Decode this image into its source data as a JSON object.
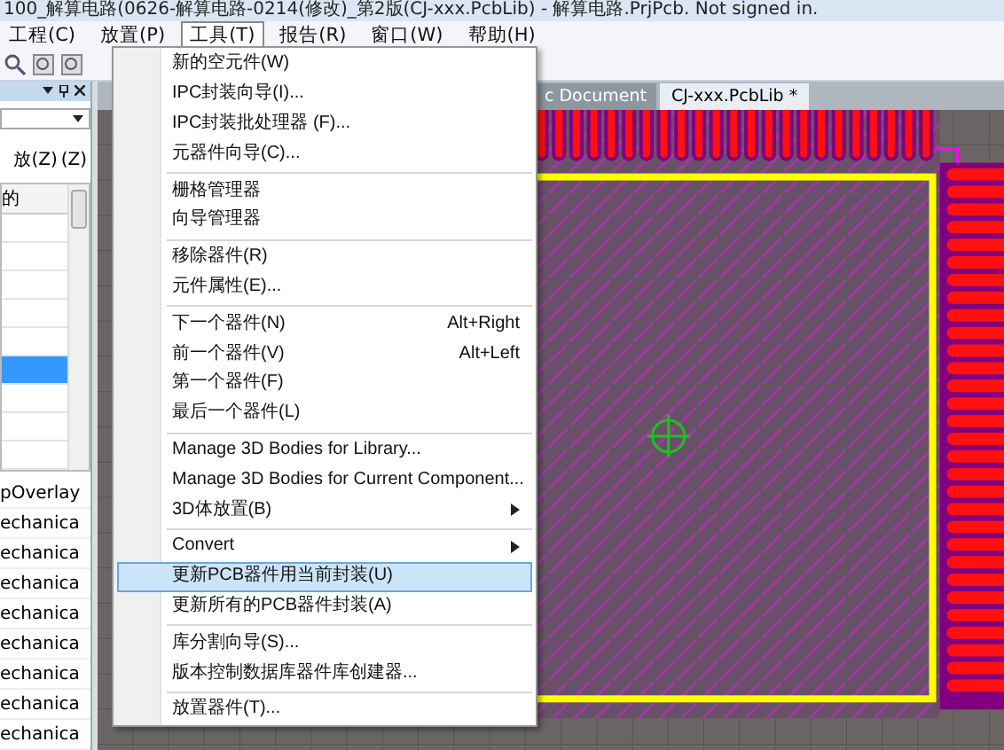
{
  "window": {
    "title": "100_解算电路(0626-解算电路-0214(修改)_第2版(CJ-xxx.PcbLib) - 解算电路.PrjPcb. Not signed in."
  },
  "menu_bar": [
    {
      "label": "工程(C)",
      "selected": false
    },
    {
      "label": "放置(P)",
      "selected": false
    },
    {
      "label": "工具(T)",
      "selected": true
    },
    {
      "label": "报告(R)",
      "selected": false
    },
    {
      "label": "窗口(W)",
      "selected": false
    },
    {
      "label": "帮助(H)",
      "selected": false
    }
  ],
  "panel": {
    "zoom_label": "放(Z)",
    "zoom_option": "(Z)",
    "column_header": "的",
    "rows": [
      {
        "selected": false
      },
      {
        "selected": false
      },
      {
        "selected": false
      },
      {
        "selected": false
      },
      {
        "selected": false
      },
      {
        "selected": true
      },
      {
        "selected": false
      },
      {
        "selected": false
      },
      {
        "selected": false
      }
    ],
    "layers": [
      "pOverlay",
      "echanica",
      "echanica",
      "echanica",
      "echanica",
      "echanica",
      "echanica",
      "echanica",
      "echanica"
    ]
  },
  "document_tabs": [
    {
      "label": "c Document",
      "selected": false
    },
    {
      "label": "CJ-xxx.PcbLib *",
      "selected": true
    }
  ],
  "tools_menu": [
    {
      "kind": "item",
      "label": "新的空元件(W)",
      "selected": false
    },
    {
      "kind": "item",
      "label": "IPC封装向导(I)...",
      "selected": false
    },
    {
      "kind": "item",
      "label": "IPC封装批处理器 (F)...",
      "selected": false
    },
    {
      "kind": "item",
      "label": "元器件向导(C)...",
      "selected": false
    },
    {
      "kind": "separator"
    },
    {
      "kind": "item",
      "label": "栅格管理器",
      "selected": false
    },
    {
      "kind": "item",
      "label": "向导管理器",
      "selected": false
    },
    {
      "kind": "separator"
    },
    {
      "kind": "item",
      "label": "移除器件(R)",
      "selected": false
    },
    {
      "kind": "item",
      "label": "元件属性(E)...",
      "selected": false
    },
    {
      "kind": "separator"
    },
    {
      "kind": "item",
      "label": "下一个器件(N)",
      "shortcut": "Alt+Right",
      "selected": false
    },
    {
      "kind": "item",
      "label": "前一个器件(V)",
      "shortcut": "Alt+Left",
      "selected": false
    },
    {
      "kind": "item",
      "label": "第一个器件(F)",
      "selected": false
    },
    {
      "kind": "item",
      "label": "最后一个器件(L)",
      "selected": false
    },
    {
      "kind": "separator"
    },
    {
      "kind": "item",
      "label": "Manage 3D Bodies for Library...",
      "selected": false
    },
    {
      "kind": "item",
      "label": "Manage 3D Bodies for Current Component...",
      "selected": false
    },
    {
      "kind": "submenu",
      "label": "3D体放置(B)",
      "selected": false
    },
    {
      "kind": "separator"
    },
    {
      "kind": "submenu",
      "label": "Convert",
      "selected": false
    },
    {
      "kind": "item",
      "label": "更新PCB器件用当前封装(U)",
      "selected": true
    },
    {
      "kind": "item",
      "label": "更新所有的PCB器件封装(A)",
      "selected": false
    },
    {
      "kind": "separator"
    },
    {
      "kind": "item",
      "label": "库分割向导(S)...",
      "selected": false
    },
    {
      "kind": "item",
      "label": "版本控制数据库器件库创建器...",
      "selected": false
    },
    {
      "kind": "separator"
    },
    {
      "kind": "item",
      "label": "放置器件(T)...",
      "selected": false
    }
  ]
}
